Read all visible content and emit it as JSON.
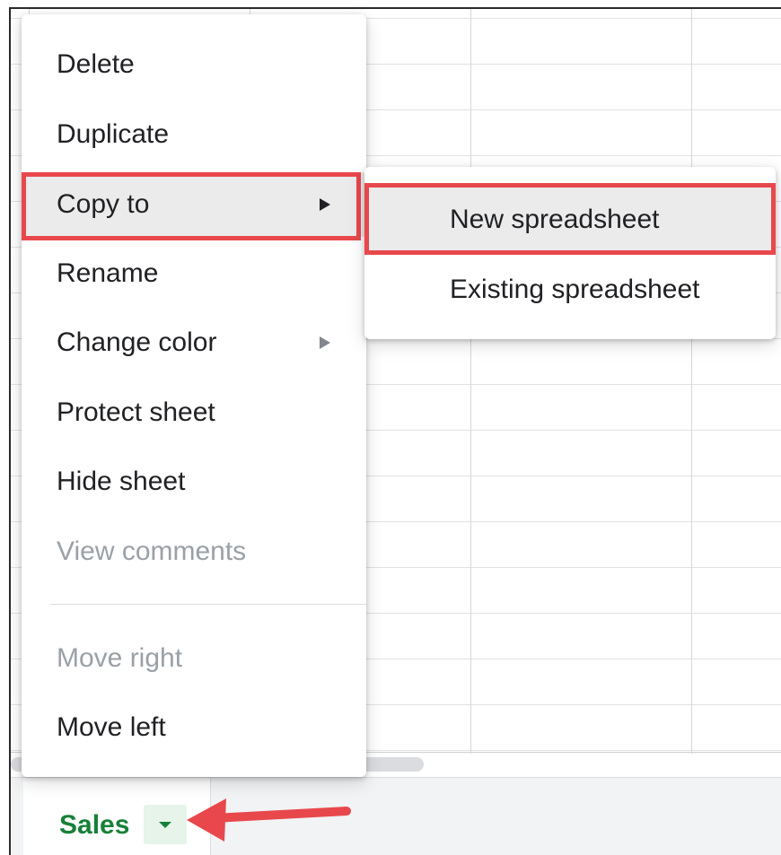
{
  "context_menu": {
    "items": [
      {
        "label": "Delete",
        "disabled": false
      },
      {
        "label": "Duplicate",
        "disabled": false
      },
      {
        "label": "Copy to",
        "disabled": false,
        "has_submenu": true,
        "highlighted": true
      },
      {
        "label": "Rename",
        "disabled": false
      },
      {
        "label": "Change color",
        "disabled": false,
        "has_submenu": true
      },
      {
        "label": "Protect sheet",
        "disabled": false
      },
      {
        "label": "Hide sheet",
        "disabled": false
      },
      {
        "label": "View comments",
        "disabled": true
      },
      {
        "label": "Move right",
        "disabled": true
      },
      {
        "label": "Move left",
        "disabled": false
      }
    ]
  },
  "submenu": {
    "items": [
      {
        "label": "New spreadsheet",
        "highlighted": true
      },
      {
        "label": "Existing spreadsheet"
      }
    ]
  },
  "sheet_tabs": {
    "active_tab": "Sales"
  },
  "colors": {
    "highlight_outline": "#e8484c",
    "active_tab_text": "#188038",
    "disabled_text": "#9aa0a6",
    "annotation_arrow": "#e8484c"
  },
  "icons": {
    "submenu_arrow": "triangle-right-icon",
    "tab_dropdown": "caret-down-icon",
    "annotation": "red-arrow-icon"
  }
}
